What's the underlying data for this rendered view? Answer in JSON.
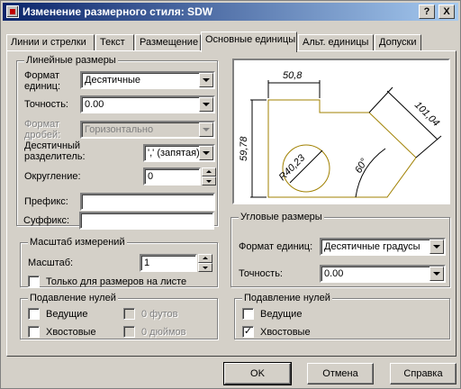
{
  "window": {
    "title": "Изменение размерного стиля: SDW",
    "help_glyph": "?",
    "close_glyph": "X"
  },
  "tabs": [
    {
      "label": "Линии и стрелки"
    },
    {
      "label": "Текст"
    },
    {
      "label": "Размещение"
    },
    {
      "label": "Основные единицы",
      "active": true
    },
    {
      "label": "Альт. единицы"
    },
    {
      "label": "Допуски"
    }
  ],
  "linear": {
    "title": "Линейные размеры",
    "unit_format_label": "Формат\nединиц:",
    "unit_format_value": "Десятичные",
    "precision_label": "Точность:",
    "precision_value": "0.00",
    "fraction_label": "Формат\nдробей:",
    "fraction_value": "Горизонтально",
    "decimal_sep_label": "Десятичный\nразделитель:",
    "decimal_sep_value": "',' (запятая)",
    "round_label": "Округление:",
    "round_value": "0",
    "prefix_label": "Префикс:",
    "prefix_value": "",
    "suffix_label": "Суффикс:",
    "suffix_value": ""
  },
  "scale": {
    "title": "Масштаб измерений",
    "scale_label": "Масштаб:",
    "scale_value": "1",
    "layout_only_label": "Только для размеров на листе",
    "layout_only_checked": false
  },
  "zero_linear": {
    "title": "Подавление нулей",
    "leading_label": "Ведущие",
    "leading_checked": false,
    "trailing_label": "Хвостовые",
    "trailing_checked": false,
    "feet_label": "0 футов",
    "inches_label": "0 дюймов"
  },
  "preview": {
    "dim_top": "50,8",
    "dim_left": "59,78",
    "dim_radius": "R40,23",
    "dim_angle": "60°",
    "dim_diag": "101,04"
  },
  "angular": {
    "title": "Угловые размеры",
    "unit_format_label": "Формат единиц:",
    "unit_format_value": "Десятичные градусы",
    "precision_label": "Точность:",
    "precision_value": "0.00"
  },
  "zero_angular": {
    "title": "Подавление нулей",
    "leading_label": "Ведущие",
    "leading_checked": false,
    "trailing_label": "Хвостовые",
    "trailing_checked": true,
    "check_glyph": "✓"
  },
  "buttons": {
    "ok": "OK",
    "cancel": "Отмена",
    "help": "Справка"
  }
}
